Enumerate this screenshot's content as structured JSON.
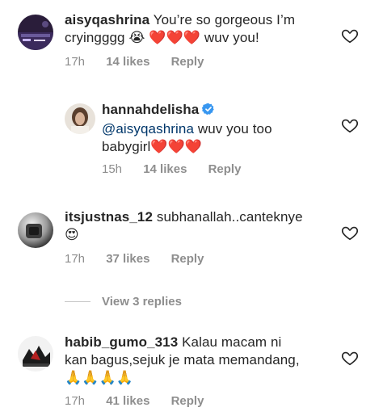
{
  "comments": [
    {
      "username": "aisyqashrina",
      "text": "You’re so gorgeous I’m cryingggg",
      "emoji_sob": "😭",
      "hearts": [
        "❤️",
        "❤️",
        "❤️"
      ],
      "text_after": "wuv you!",
      "time": "17h",
      "likes": "14 likes",
      "reply": "Reply"
    },
    {
      "username": "hannahdelisha",
      "mention": "@aisyqashrina",
      "text": "wuv you too babygirl",
      "hearts": [
        "❤️",
        "❤️",
        "❤️"
      ],
      "time": "15h",
      "likes": "14 likes",
      "reply": "Reply"
    },
    {
      "username": "itsjustnas_12",
      "text": "subhanallah..canteknye",
      "emoji": "😍",
      "time": "17h",
      "likes": "37 likes",
      "reply": "Reply"
    },
    {
      "username": "habib_gumo_313",
      "text": "Kalau macam ni kan bagus,sejuk je mata memandang,",
      "emoji_pray": [
        "🙏",
        "🙏",
        "🙏",
        "🙏"
      ],
      "time": "17h",
      "likes": "41 likes",
      "reply": "Reply"
    }
  ],
  "view_replies": "View 3 replies",
  "icons": {
    "like": "heart-outline-icon",
    "verified": "verified-badge-icon"
  },
  "colors": {
    "username": "#262626",
    "mention": "#00376b",
    "meta": "#8e8e8e",
    "verified": "#3897f0"
  }
}
